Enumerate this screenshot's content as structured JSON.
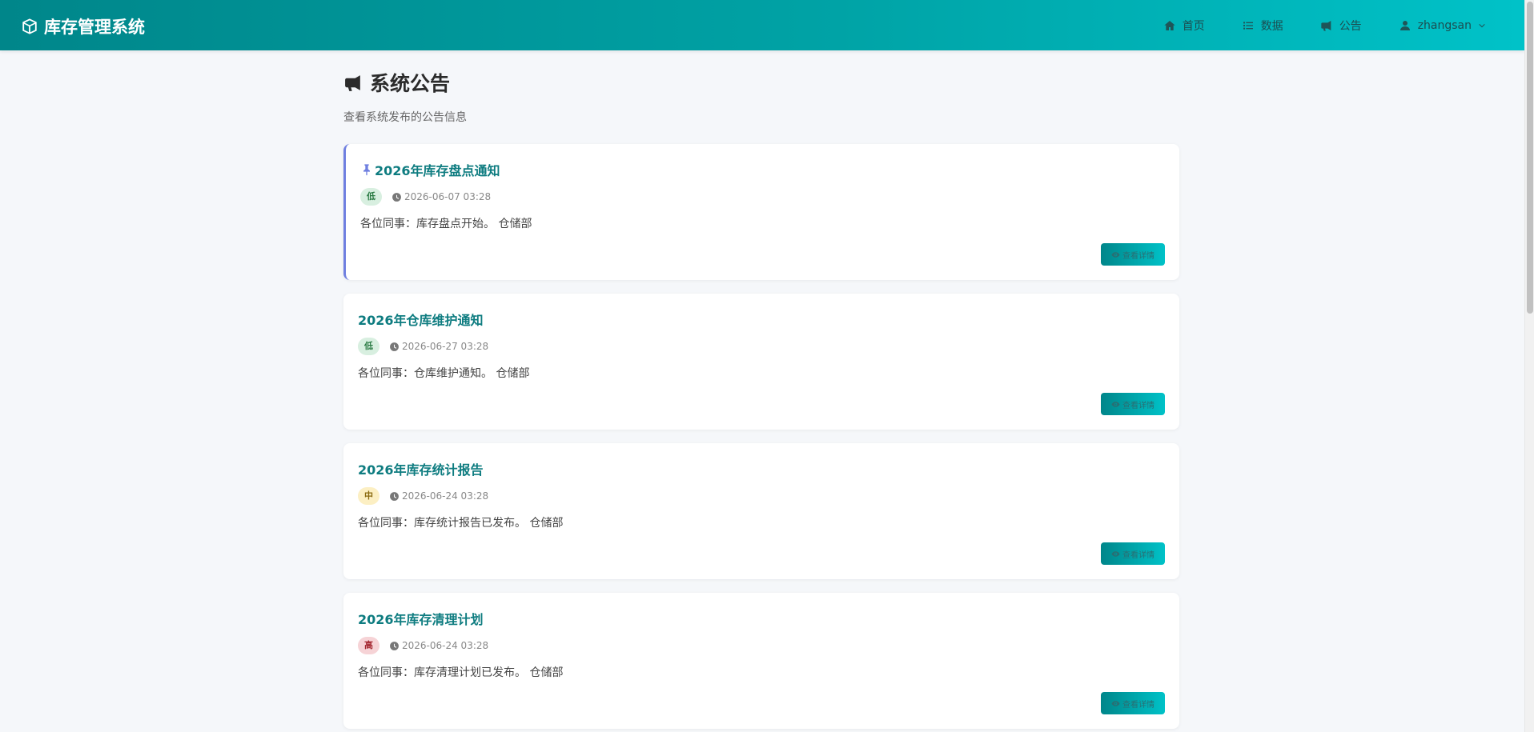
{
  "navbar": {
    "brand": "库存管理系统",
    "items": [
      {
        "label": "首页",
        "icon": "home-icon"
      },
      {
        "label": "数据",
        "icon": "list-icon"
      },
      {
        "label": "公告",
        "icon": "megaphone-icon"
      }
    ],
    "user": {
      "name": "zhangsan",
      "icon": "user-icon"
    }
  },
  "page": {
    "title": "系统公告",
    "subtitle": "查看系统发布的公告信息"
  },
  "announcements": [
    {
      "title": "2026年库存盘点通知",
      "priority": "低",
      "date": "2026-06-07 03:28",
      "content": "各位同事：库存盘点开始。 仓储部",
      "pinned": true
    },
    {
      "title": "2026年仓库维护通知",
      "priority": "低",
      "date": "2026-06-27 03:28",
      "content": "各位同事：仓库维护通知。 仓储部",
      "pinned": false
    },
    {
      "title": "2026年库存统计报告",
      "priority": "中",
      "date": "2026-06-24 03:28",
      "content": "各位同事：库存统计报告已发布。 仓储部",
      "pinned": false
    },
    {
      "title": "2026年库存清理计划",
      "priority": "高",
      "date": "2026-06-24 03:28",
      "content": "各位同事：库存清理计划已发布。 仓储部",
      "pinned": false
    }
  ],
  "detail_button_label": "查看详情",
  "colors": {
    "nav_start": "#00868a",
    "nav_end": "#00c2c8",
    "title_teal": "#0e7c80",
    "pin_accent": "#6f7fe0",
    "badge_low": "#d8efe0",
    "badge_mid": "#fcefc3",
    "badge_high": "#f6d3d6"
  }
}
